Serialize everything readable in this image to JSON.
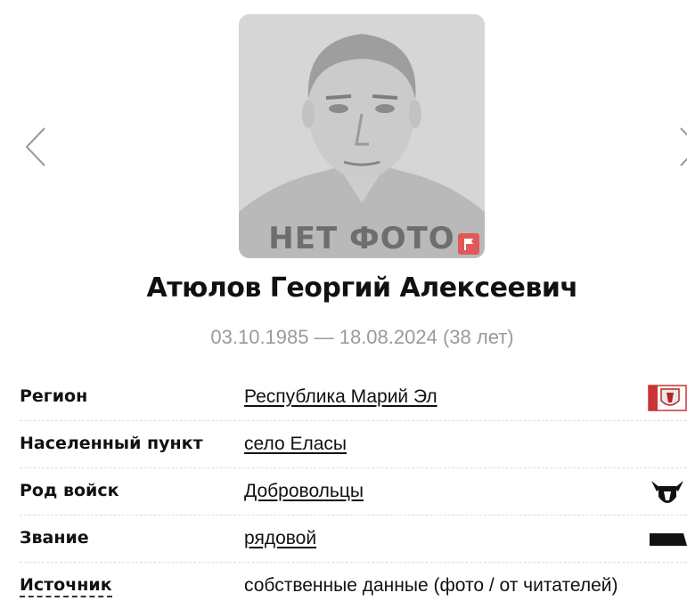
{
  "photo": {
    "caption": "НЕТ ФОТО",
    "flag_icon": "flag-icon",
    "flag_color": "#e05858"
  },
  "person": {
    "name": "Атюлов Георгий Алексеевич",
    "dates": "03.10.1985 — 18.08.2024 (38 лет)"
  },
  "info": {
    "region": {
      "label": "Регион",
      "value": "Республика Марий Эл",
      "icon": "region-coat-of-arms-icon"
    },
    "locality": {
      "label": "Населенный пункт",
      "value": "село Еласы"
    },
    "branch": {
      "label": "Род войск",
      "value": "Добровольцы",
      "icon": "volunteers-emblem-icon"
    },
    "rank": {
      "label": "Звание",
      "value": "рядовой",
      "icon": "rank-insignia-icon"
    },
    "source": {
      "label": "Источник",
      "value": "собственные данные (фото / от читателей)"
    }
  },
  "nav": {
    "prev_icon": "chevron-left-icon",
    "next_icon": "chevron-right-icon"
  }
}
